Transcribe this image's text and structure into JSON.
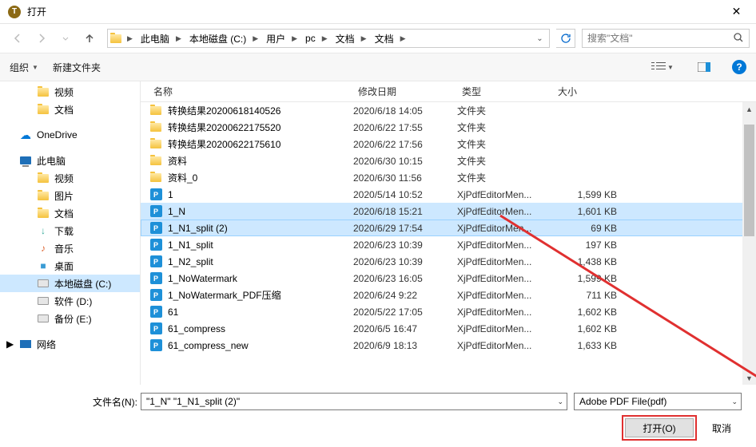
{
  "title": "打开",
  "breadcrumb": [
    "此电脑",
    "本地磁盘 (C:)",
    "用户",
    "pc",
    "文档",
    "文档"
  ],
  "search_placeholder": "搜索\"文档\"",
  "toolbar": {
    "organize": "组织",
    "new_folder": "新建文件夹"
  },
  "sidebar": {
    "quick": [
      {
        "label": "视频",
        "icon": "video"
      },
      {
        "label": "文档",
        "icon": "doc"
      }
    ],
    "onedrive": "OneDrive",
    "this_pc": "此电脑",
    "pc_children": [
      {
        "label": "视频",
        "icon": "video"
      },
      {
        "label": "图片",
        "icon": "pic"
      },
      {
        "label": "文档",
        "icon": "doc"
      },
      {
        "label": "下载",
        "icon": "download"
      },
      {
        "label": "音乐",
        "icon": "music"
      },
      {
        "label": "桌面",
        "icon": "desktop"
      },
      {
        "label": "本地磁盘 (C:)",
        "icon": "disk",
        "selected": true
      },
      {
        "label": "软件 (D:)",
        "icon": "disk"
      },
      {
        "label": "备份 (E:)",
        "icon": "disk"
      }
    ],
    "network": "网络"
  },
  "columns": {
    "name": "名称",
    "date": "修改日期",
    "type": "类型",
    "size": "大小"
  },
  "files": [
    {
      "name": "转换结果20200618140526",
      "date": "2020/6/18 14:05",
      "type": "文件夹",
      "size": "",
      "kind": "folder"
    },
    {
      "name": "转换结果20200622175520",
      "date": "2020/6/22 17:55",
      "type": "文件夹",
      "size": "",
      "kind": "folder"
    },
    {
      "name": "转换结果20200622175610",
      "date": "2020/6/22 17:56",
      "type": "文件夹",
      "size": "",
      "kind": "folder"
    },
    {
      "name": "资料",
      "date": "2020/6/30 10:15",
      "type": "文件夹",
      "size": "",
      "kind": "folder"
    },
    {
      "name": "资料_0",
      "date": "2020/6/30 11:56",
      "type": "文件夹",
      "size": "",
      "kind": "folder"
    },
    {
      "name": "1",
      "date": "2020/5/14 10:52",
      "type": "XjPdfEditorMen...",
      "size": "1,599 KB",
      "kind": "pdf"
    },
    {
      "name": "1_N",
      "date": "2020/6/18 15:21",
      "type": "XjPdfEditorMen...",
      "size": "1,601 KB",
      "kind": "pdf",
      "selected": true
    },
    {
      "name": "1_N1_split (2)",
      "date": "2020/6/29 17:54",
      "type": "XjPdfEditorMen...",
      "size": "69 KB",
      "kind": "pdf",
      "selected": true,
      "focused": true
    },
    {
      "name": "1_N1_split",
      "date": "2020/6/23 10:39",
      "type": "XjPdfEditorMen...",
      "size": "197 KB",
      "kind": "pdf"
    },
    {
      "name": "1_N2_split",
      "date": "2020/6/23 10:39",
      "type": "XjPdfEditorMen...",
      "size": "1,438 KB",
      "kind": "pdf"
    },
    {
      "name": "1_NoWatermark",
      "date": "2020/6/23 16:05",
      "type": "XjPdfEditorMen...",
      "size": "1,599 KB",
      "kind": "pdf"
    },
    {
      "name": "1_NoWatermark_PDF压缩",
      "date": "2020/6/24 9:22",
      "type": "XjPdfEditorMen...",
      "size": "711 KB",
      "kind": "pdf"
    },
    {
      "name": "61",
      "date": "2020/5/22 17:05",
      "type": "XjPdfEditorMen...",
      "size": "1,602 KB",
      "kind": "pdf"
    },
    {
      "name": "61_compress",
      "date": "2020/6/5 16:47",
      "type": "XjPdfEditorMen...",
      "size": "1,602 KB",
      "kind": "pdf"
    },
    {
      "name": "61_compress_new",
      "date": "2020/6/9 18:13",
      "type": "XjPdfEditorMen...",
      "size": "1,633 KB",
      "kind": "pdf"
    }
  ],
  "filename_label": "文件名(N):",
  "filename_value": "\"1_N\" \"1_N1_split (2)\"",
  "filetype_value": "Adobe PDF File(pdf)",
  "open_btn": "打开(O)",
  "cancel_btn": "取消"
}
